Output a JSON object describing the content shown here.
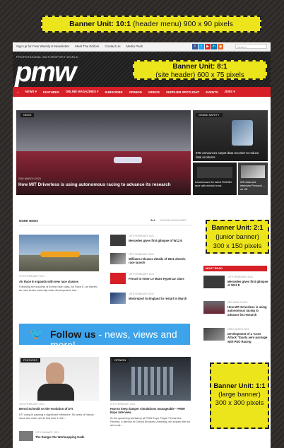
{
  "banners": {
    "header_menu": {
      "label": "Banner Unit: 10:1",
      "detail": "(header menu)  900 x 90 pixels"
    },
    "site_header": {
      "label": "Banner Unit: 8:1",
      "detail": "(site header)  600 x 75 pixels"
    },
    "junior": {
      "label": "Banner Unit: 2:1",
      "line2": "(junior banner)",
      "line3": "300 x 150 pixels"
    },
    "large": {
      "label": "Banner Unit: 1:1",
      "line2": "(large banner)",
      "line3": "300 x 300 pixels"
    }
  },
  "topbar": {
    "links": [
      "Sign up for Free Weekly E-Newsletter",
      "Meet The Editors",
      "Contact Us",
      "Media Pack"
    ],
    "social_icons": [
      "facebook-icon",
      "twitter-icon",
      "youtube-icon",
      "linkedin-icon",
      "rss-icon"
    ],
    "social_colors": [
      "#3b5998",
      "#1da1f2",
      "#e02a20",
      "#0077b5",
      "#f26522"
    ],
    "search_placeholder": "Search"
  },
  "site": {
    "tagline": "PROFESSIONAL MOTORSPORT WORLD",
    "logo": "pmw"
  },
  "nav": {
    "items": [
      "⌂",
      "NEWS ▾",
      "FEATURES",
      "ONLINE MAGAZINES ▾",
      "SUBSCRIBE",
      "OPINION",
      "VIDEOS",
      "SUPPLIER SPOTLIGHT",
      "EVENTS",
      "JOBS ▾"
    ]
  },
  "hero": {
    "tag": "NEWS",
    "date": "2ND MARCH 2021",
    "title": "How MIT Driverless is using autonomous racing to advance its research"
  },
  "side_stories": [
    {
      "tag": "GRAND SAFETY",
      "title": "ZTE announces carpet data recorder to reduce fatal accidents"
    },
    {
      "title": "Leaderboard for latest ROUND race with electric track"
    },
    {
      "title": "iOS data and interview Pennzoil ... on UK"
    }
  ],
  "more_news": {
    "heading": "MORE NEWS",
    "filters": [
      "ALL",
      "ONLINE MAGAZINES"
    ],
    "lead": {
      "date": "12TH FEBRUARY 2021",
      "title": "Air Race E expands with new race classes",
      "excerpt": "Following the success of its first race class, Air Race E, an electric air race series currently under development, has..."
    },
    "list": [
      {
        "date": "15TH FEBRUARY 2021",
        "title": "Mercedes gives first glimpse of W12 E"
      },
      {
        "date": "15TH FEBRUARY 2021",
        "title": "Williams releases details of 2021 electric race launch"
      },
      {
        "date": "15TH FEBRUARY 2021",
        "title": "Ferrari to enter Le Mans Hypercar class"
      },
      {
        "date": "15TH FEBRUARY 2021",
        "title": "Motorsport to England to restart in March"
      }
    ]
  },
  "follow": {
    "prefix": "Follow us",
    "suffix": " - news, views and more!"
  },
  "most_read": {
    "heading": "MOST READ",
    "items": [
      {
        "date": "15TH FEBRUARY 2021",
        "title": "Mercedes gives first glimpse of W12 E"
      },
      {
        "date": "2ND MARCH 2021",
        "title": "How MIT Driverless is using autonomous racing to advance its research"
      },
      {
        "date": "23RD MARCH 2021",
        "title": "Development of a 'Cone Attack' Toyota aero package with PEO Racing"
      }
    ]
  },
  "features": {
    "tag": "FEATURES",
    "date": "15TH FEBRUARY 2021",
    "title": "Bernd Schmidt on the evolution of DTI",
    "excerpt": "DTI using is passing a significant milestone: 50 years of history since the crash ran its first race in the...",
    "next_date": "15TH JANUARY 2021",
    "next_title": "The Danger the Workaspping trade"
  },
  "opinion": {
    "tag": "OPINION",
    "date": "11TH FEBRUARY 2021",
    "title": "How to keep damper simulations manageable – PMW Expo Interview",
    "excerpt": "At the upcoming workshop at PMW Expo, Roger Fernandes Ferreira, a director at Oxford Brookes University, will explain the ins and outs..."
  }
}
